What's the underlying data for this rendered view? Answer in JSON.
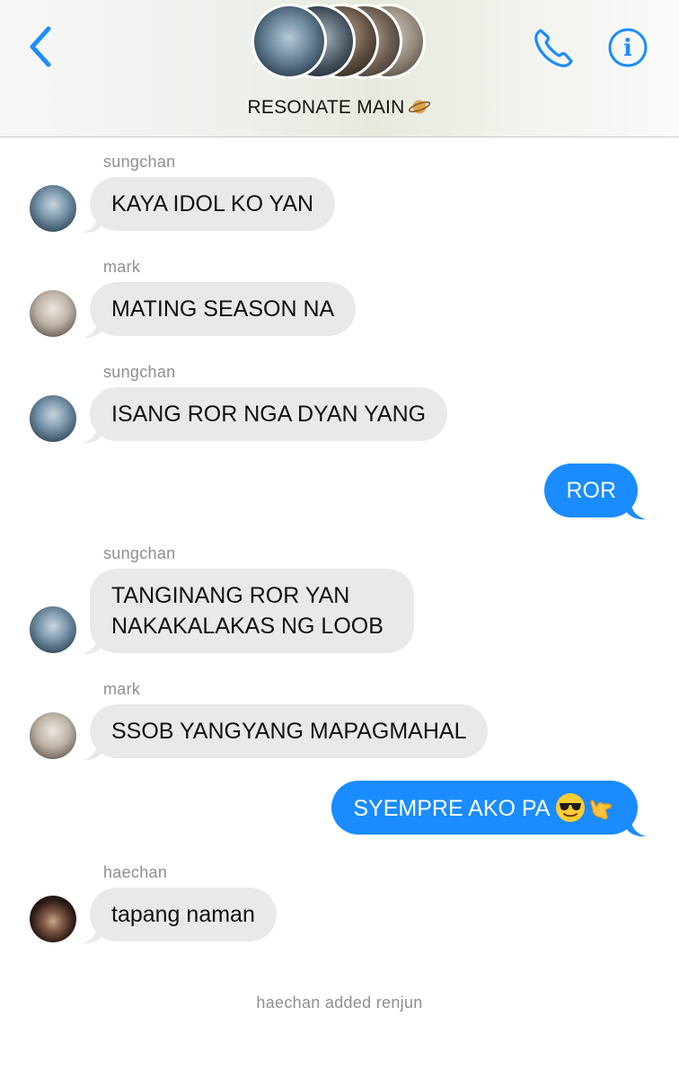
{
  "header": {
    "back_icon": "chevron-left-icon",
    "group_name": "RESONATE MAIN",
    "group_emoji": "ringed-planet-emoji",
    "call_icon": "phone-icon",
    "info_icon": "info-icon",
    "info_glyph": "i",
    "accent_color": "#1a8cff"
  },
  "messages": [
    {
      "sender": "sungchan",
      "text": "KAYA IDOL KO YAN",
      "direction": "incoming"
    },
    {
      "sender": "mark",
      "text": "MATING SEASON NA",
      "direction": "incoming"
    },
    {
      "sender": "sungchan",
      "text": "ISANG ROR NGA DYAN YANG",
      "direction": "incoming"
    },
    {
      "sender": "",
      "text": "ROR",
      "direction": "outgoing"
    },
    {
      "sender": "sungchan",
      "text": "TANGINANG ROR YAN NAKAKALAKAS NG LOOB",
      "direction": "incoming"
    },
    {
      "sender": "mark",
      "text": "SSOB YANGYANG MAPAGMAHAL",
      "direction": "incoming"
    },
    {
      "sender": "",
      "text": "SYEMPRE AKO PA",
      "emojis": [
        "smiling-face-with-sunglasses",
        "call-me-hand"
      ],
      "direction": "outgoing"
    },
    {
      "sender": "haechan",
      "text": "tapang naman",
      "direction": "incoming"
    }
  ],
  "system": {
    "text": "haechan added renjun"
  },
  "colors": {
    "incoming_bubble": "#e9e9eb",
    "outgoing_bubble": "#1a8cff",
    "meta_text": "#8e8e93"
  }
}
